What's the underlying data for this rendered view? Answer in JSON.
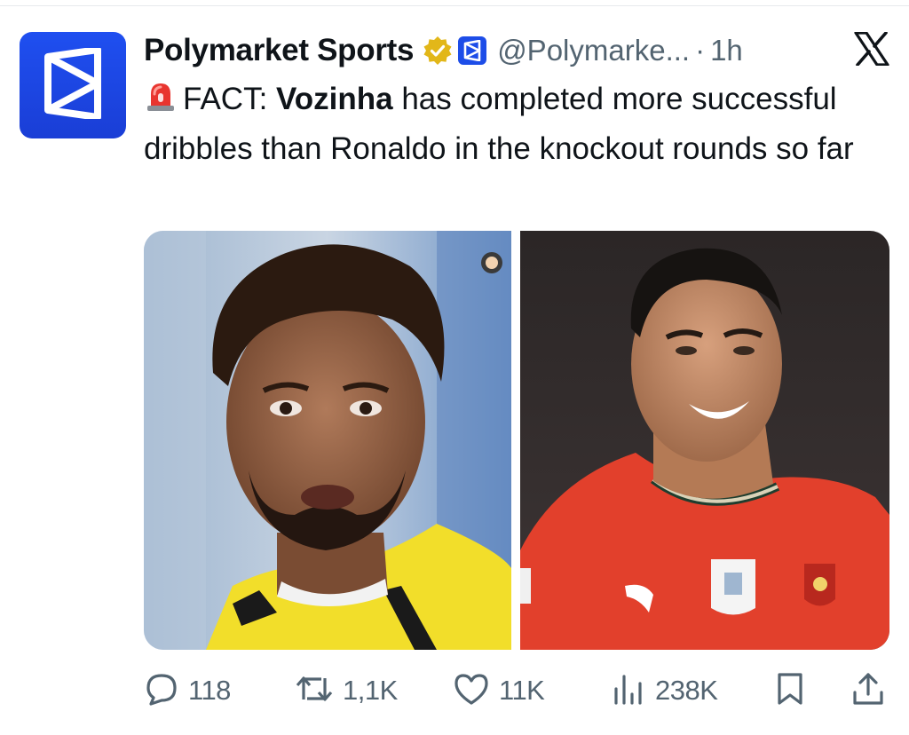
{
  "tweet": {
    "author_name": "Polymarket Sports",
    "handle": "@Polymarke...",
    "separator": "·",
    "time": "1h",
    "text_prefix": "FACT: ",
    "text_bold": "Vozinha",
    "text_rest": " has completed more successful dribbles than Ronaldo in the knockout rounds so far"
  },
  "actions": {
    "replies": "118",
    "reposts": "1,1K",
    "likes": "11K",
    "views": "238K"
  },
  "icons": {
    "avatar": "polymarket-logo-icon",
    "verified": "verified-badge-icon",
    "affiliate": "affiliate-badge-icon",
    "platform": "x-logo-icon",
    "siren": "siren-emoji-icon",
    "reply": "reply-icon",
    "repost": "repost-icon",
    "like": "like-icon",
    "views": "views-icon",
    "bookmark": "bookmark-icon",
    "share": "share-icon"
  },
  "colors": {
    "brand_blue": "#1d4de8",
    "verified_gold": "#e2b719",
    "text_primary": "#0f1419",
    "text_secondary": "#536471"
  }
}
